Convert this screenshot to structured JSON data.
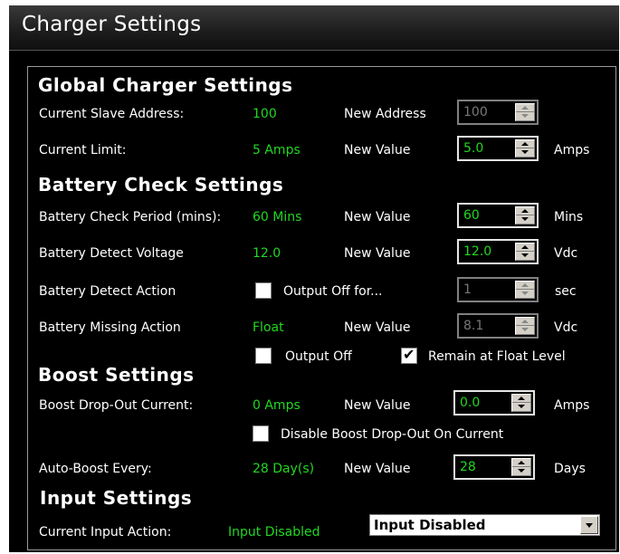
{
  "window": {
    "title": "Charger Settings"
  },
  "global": {
    "heading": "Global Charger Settings",
    "slave_label": "Current Slave Address:",
    "slave_value": "100",
    "new_address_label": "New Address",
    "new_address_value": "100",
    "limit_label": "Current Limit:",
    "limit_value": "5 Amps",
    "limit_new_label": "New Value",
    "limit_new_value": "5.0",
    "limit_unit": "Amps"
  },
  "battery": {
    "heading": "Battery Check Settings",
    "period_label": "Battery Check Period (mins):",
    "period_value": "60 Mins",
    "period_new_label": "New Value",
    "period_new_value": "60",
    "period_unit": "Mins",
    "voltage_label": "Battery Detect Voltage",
    "voltage_value": "12.0",
    "voltage_new_label": "New Value",
    "voltage_new_value": "12.0",
    "voltage_unit": "Vdc",
    "action_label": "Battery Detect Action",
    "output_off_for_label": "Output Off for...",
    "output_off_for_checked": false,
    "action_new_value": "1",
    "action_unit": "sec",
    "missing_label": "Battery Missing Action",
    "missing_value": "Float",
    "missing_new_label": "New Value",
    "missing_new_value": "8.1",
    "missing_unit": "Vdc",
    "output_off_label": "Output Off",
    "output_off_checked": false,
    "remain_float_label": "Remain at Float Level",
    "remain_float_checked": true
  },
  "boost": {
    "heading": "Boost Settings",
    "dropout_label": "Boost Drop-Out Current:",
    "dropout_value": "0 Amps",
    "dropout_new_label": "New Value",
    "dropout_new_value": "0.0",
    "dropout_unit": "Amps",
    "disable_label": "Disable Boost Drop-Out On Current",
    "disable_checked": false,
    "auto_label": "Auto-Boost Every:",
    "auto_value": "28 Day(s)",
    "auto_new_label": "New Value",
    "auto_new_value": "28",
    "auto_unit": "Days"
  },
  "input": {
    "heading": "Input Settings",
    "current_label": "Current Input Action:",
    "current_value": "Input Disabled",
    "select_value": "Input Disabled"
  },
  "colors": {
    "value_green": "#21d721",
    "background": "#000000",
    "text": "#ffffff"
  }
}
